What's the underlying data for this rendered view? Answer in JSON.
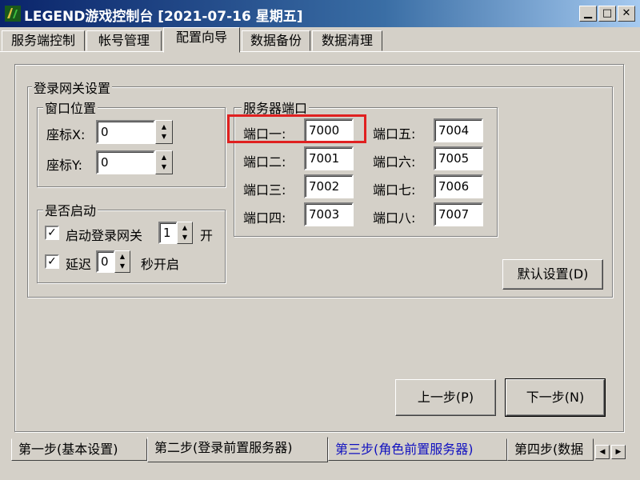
{
  "window": {
    "title": "LEGEND游戏控制台 [2021-07-16 星期五]"
  },
  "top_tabs": [
    "服务端控制",
    "帐号管理",
    "配置向导",
    "数据备份",
    "数据清理"
  ],
  "login_gateway": {
    "title": "登录网关设置",
    "window_position": {
      "title": "窗口位置",
      "x_label": "座标X:",
      "x_value": "0",
      "y_label": "座标Y:",
      "y_value": "0"
    },
    "enable": {
      "title": "是否启动",
      "start_label": "启动登录网关",
      "start_count": "1",
      "start_suffix": "开",
      "delay_label": "延迟",
      "delay_value": "0",
      "delay_suffix": "秒开启"
    },
    "server_ports": {
      "title": "服务器端口",
      "ports": [
        {
          "label": "端口一:",
          "value": "7000"
        },
        {
          "label": "端口二:",
          "value": "7001"
        },
        {
          "label": "端口三:",
          "value": "7002"
        },
        {
          "label": "端口四:",
          "value": "7003"
        },
        {
          "label": "端口五:",
          "value": "7004"
        },
        {
          "label": "端口六:",
          "value": "7005"
        },
        {
          "label": "端口七:",
          "value": "7006"
        },
        {
          "label": "端口八:",
          "value": "7007"
        }
      ]
    },
    "default_button": "默认设置(D)"
  },
  "nav": {
    "prev": "上一步(P)",
    "next": "下一步(N)"
  },
  "bottom_tabs": [
    "第一步(基本设置)",
    "第二步(登录前置服务器)",
    "第三步(角色前置服务器)",
    "第四步(数据"
  ],
  "colors": {
    "title_bar": "#0a246a",
    "highlight": "#e02020",
    "link_tab": "#1010c0"
  }
}
